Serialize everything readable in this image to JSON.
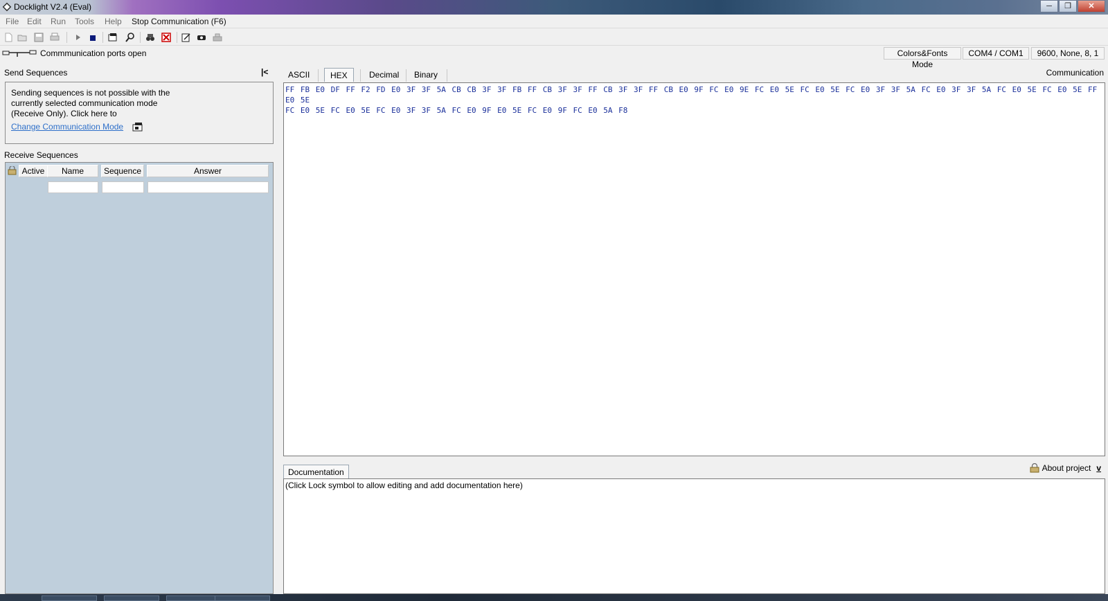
{
  "window": {
    "title": "Docklight V2.4 (Eval)",
    "minimize": "─",
    "maximize": "❐",
    "close": "✕"
  },
  "menu": {
    "items": [
      "File",
      "Edit",
      "Run",
      "Tools",
      "Help",
      "Stop Communication  (F6)"
    ]
  },
  "toolbar": {
    "icons": [
      "new-file-icon",
      "open-folder-icon",
      "save-icon",
      "print-icon",
      "play-icon",
      "stop-icon",
      "settings-icon",
      "search-icon",
      "binoculars-icon",
      "clear-icon",
      "edit-icon",
      "snapshot-icon",
      "keyboard-icon"
    ]
  },
  "status": {
    "text": "Commmunication ports open",
    "mode": "Colors&Fonts Mode",
    "ports": "COM4 / COM1",
    "settings": "9600, None, 8, 1"
  },
  "send": {
    "label": "Send Sequences",
    "message": "Sending sequences is not possible with the currently selected communication mode (Receive Only). Click here to",
    "link": "Change Communication Mode",
    "collapse": "|<"
  },
  "receive": {
    "label": "Receive Sequences",
    "columns": [
      "Active",
      "Name",
      "Sequence",
      "Answer"
    ]
  },
  "tabs": [
    "ASCII",
    "HEX",
    "Decimal",
    "Binary"
  ],
  "selected_tab": "HEX",
  "communication": {
    "label": "Communication",
    "hex_line1": "FF FB E0 DF FF F2 FD E0 3F 3F 5A CB CB 3F 3F FB FF CB 3F 3F FF CB 3F 3F FF CB E0 9F FC E0 9E FC E0 5E FC E0 5E FC E0 3F 3F 5A FC E0 3F 3F 5A FC E0 5E FC E0 5E FF E0 5E",
    "hex_line2": "FC E0 5E FC E0 5E FC E0 3F 3F 5A FC E0 9F E0 5E FC E0 9F FC E0 5A F8"
  },
  "documentation": {
    "tab": "Documentation",
    "about": "About project",
    "collapse": "v",
    "placeholder": "(Click Lock symbol to allow editing and add documentation here)"
  },
  "colors": {
    "receive_panel_bg": "#bfcfdc",
    "hex_text": "#1a2f9a",
    "link": "#2d6fc9"
  }
}
